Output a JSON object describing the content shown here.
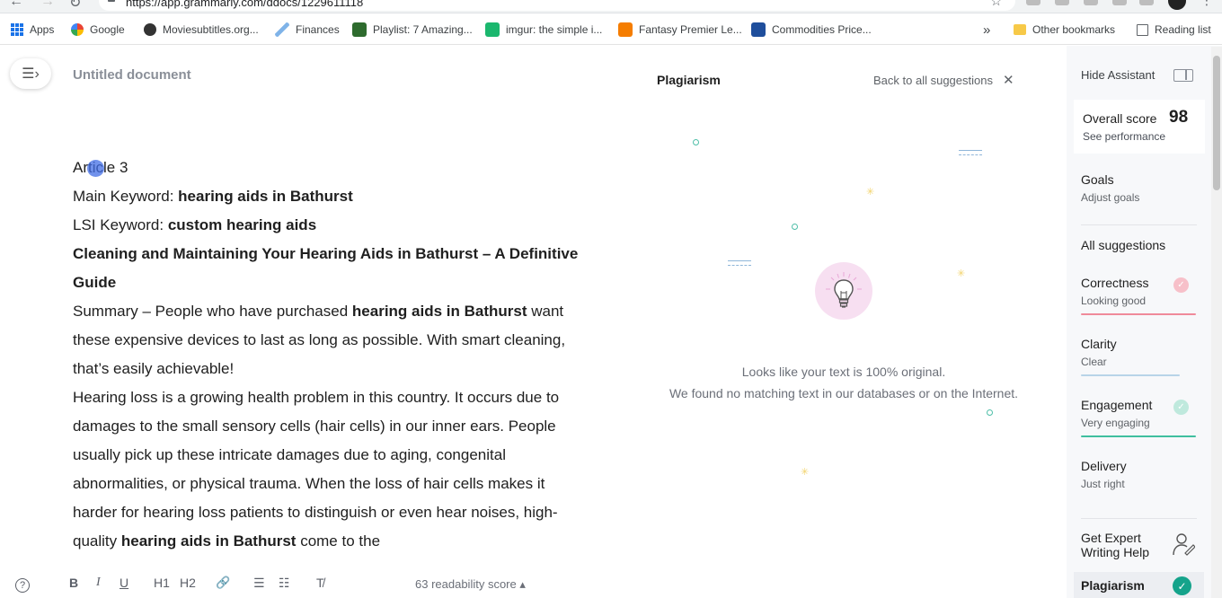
{
  "browser": {
    "url": "https://app.grammarly.com/ddocs/1229611118",
    "bookmarks": [
      {
        "label": "Apps",
        "icon": "apps-grid-icon"
      },
      {
        "label": "Google",
        "icon": "google-icon"
      },
      {
        "label": "Moviesubtitles.org...",
        "icon": "film-icon"
      },
      {
        "label": "Finances",
        "icon": "finances-icon"
      },
      {
        "label": "Playlist: 7 Amazing...",
        "icon": "playlist-icon"
      },
      {
        "label": "imgur: the simple i...",
        "icon": "imgur-icon"
      },
      {
        "label": "Fantasy Premier Le...",
        "icon": "blogger-icon"
      },
      {
        "label": "Commodities Price...",
        "icon": "commodities-icon"
      }
    ],
    "overflow_label": "»",
    "other_bookmarks": "Other bookmarks",
    "reading_list": "Reading list"
  },
  "editor": {
    "doc_title": "Untitled document",
    "lines": [
      {
        "parts": [
          {
            "text": "Article 3",
            "bold": false
          }
        ]
      },
      {
        "parts": [
          {
            "text": "Main Keyword: ",
            "bold": false
          },
          {
            "text": "hearing aids in Bathurst",
            "bold": true
          }
        ]
      },
      {
        "parts": [
          {
            "text": "LSI Keyword: ",
            "bold": false
          },
          {
            "text": "custom hearing aids",
            "bold": true
          }
        ]
      },
      {
        "parts": [
          {
            "text": "Cleaning and Maintaining Your Hearing Aids in Bathurst – A Definitive Guide",
            "bold": true
          }
        ]
      },
      {
        "parts": [
          {
            "text": "Summary – People who have purchased ",
            "bold": false
          },
          {
            "text": "hearing aids in Bathurst",
            "bold": true
          },
          {
            "text": " want these expensive devices to last as long as possible. With smart cleaning, that’s easily achievable!",
            "bold": false
          }
        ]
      },
      {
        "parts": [
          {
            "text": "Hearing loss is a growing health problem in this country. It occurs due to damages to the small sensory cells (hair cells) in our inner ears. People usually pick up these intricate damages due to aging, congenital abnormalities, or physical trauma. When the loss of hair cells makes it harder for hearing loss patients to distinguish or even hear noises, high-quality ",
            "bold": false
          },
          {
            "text": "hearing aids in Bathurst",
            "bold": true
          },
          {
            "text": " come to the",
            "bold": false
          }
        ]
      }
    ],
    "toolbar": {
      "help": "?",
      "bold": "B",
      "italic": "I",
      "underline": "U",
      "h1": "H1",
      "h2": "H2",
      "link": "🔗",
      "ordered_list": "☰",
      "bullet_list": "☷",
      "clear_format": "T̸"
    },
    "readability": "63 readability score ▴"
  },
  "plagiarism": {
    "title": "Plagiarism",
    "back_link": "Back to all suggestions",
    "close": "✕",
    "message_line1": "Looks like your text is 100% original.",
    "message_line2": "We found no matching text in our databases or on the Internet."
  },
  "assistant": {
    "hide_label": "Hide Assistant",
    "overall_label": "Overall score",
    "overall_score": "98",
    "see_performance": "See performance",
    "goals": "Goals",
    "adjust_goals": "Adjust goals",
    "all_suggestions": "All suggestions",
    "categories": [
      {
        "name": "Correctness",
        "status": "Looking good",
        "color": "#f08a9a"
      },
      {
        "name": "Clarity",
        "status": "Clear",
        "color": "#b8d4e8"
      },
      {
        "name": "Engagement",
        "status": "Very engaging",
        "color": "#3fbf9f"
      },
      {
        "name": "Delivery",
        "status": "Just right",
        "color": "#cccccc"
      }
    ],
    "expert_line1": "Get Expert",
    "expert_line2": "Writing Help",
    "plagiarism_label": "Plagiarism"
  }
}
